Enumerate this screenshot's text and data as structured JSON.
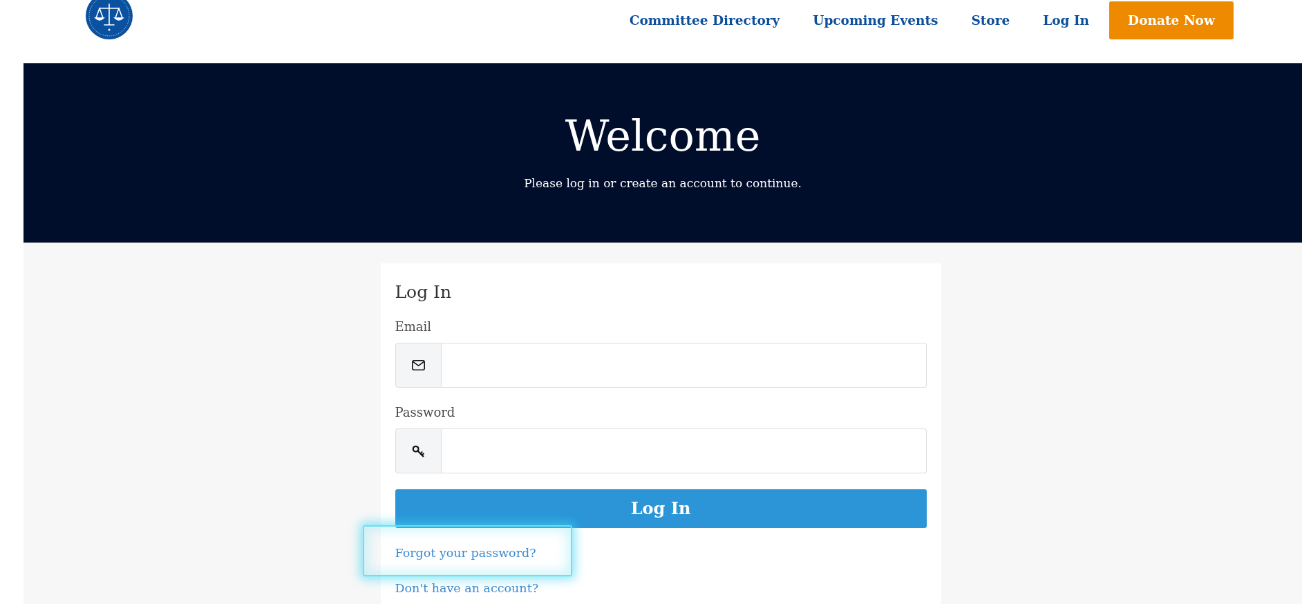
{
  "header": {
    "nav": [
      {
        "label": "Committee Directory"
      },
      {
        "label": "Upcoming Events"
      },
      {
        "label": "Store"
      },
      {
        "label": "Log In"
      }
    ],
    "donate_button": "Donate Now"
  },
  "banner": {
    "title": "Welcome",
    "subtitle": "Please log in or create an account to continue."
  },
  "login_card": {
    "title": "Log In",
    "fields": [
      {
        "kind": "email",
        "label": "Email"
      },
      {
        "kind": "password",
        "label": "Password"
      }
    ],
    "submit_button": "Log In",
    "links": [
      {
        "text": "Forgot your password?",
        "highlighted": true
      },
      {
        "text": "Don't have an account?",
        "highlighted": false
      }
    ]
  }
}
